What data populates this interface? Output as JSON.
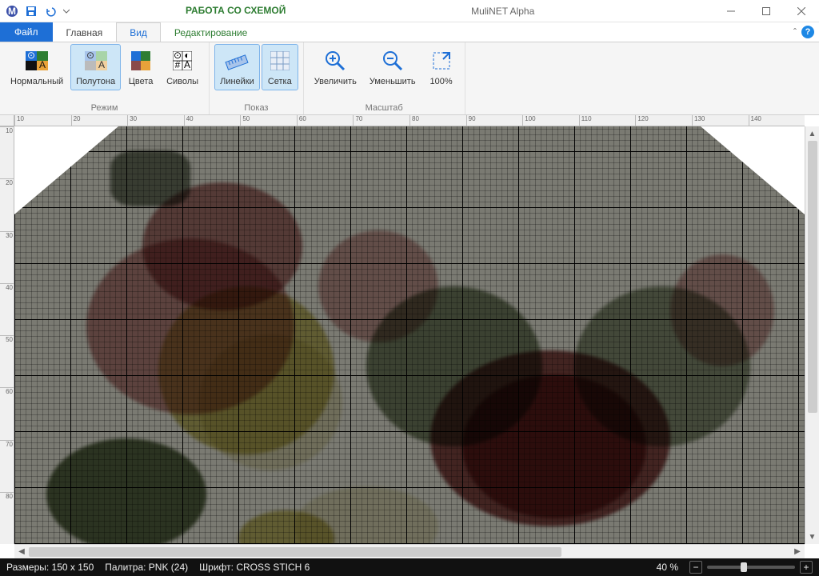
{
  "app": {
    "title": "MuliNET Alpha"
  },
  "context_tab": {
    "title": "РАБОТА СО СХЕМОЙ",
    "subtitle": "Редактирование"
  },
  "tabs": {
    "file": "Файл",
    "home": "Главная",
    "view": "Вид"
  },
  "ribbon": {
    "groups": {
      "mode": {
        "label": "Режим",
        "normal": "Нормальный",
        "halftone": "Полутона",
        "colors": "Цвета",
        "symbols": "Сиволы"
      },
      "show": {
        "label": "Показ",
        "rulers": "Линейки",
        "grid": "Сетка"
      },
      "zoom": {
        "label": "Масштаб",
        "zoom_in": "Увеличить",
        "zoom_out": "Уменьшить",
        "fit": "100%"
      }
    }
  },
  "ruler_marks": [
    "10",
    "20",
    "30",
    "40",
    "50",
    "60",
    "70",
    "80",
    "90",
    "100",
    "110",
    "120",
    "130",
    "140"
  ],
  "status": {
    "dims_label": "Размеры:",
    "dims_value": "150 x 150",
    "palette_label": "Палитра:",
    "palette_value": "PNK (24)",
    "font_label": "Шрифт:",
    "font_value": "CROSS STICH 6",
    "zoom_value": "40 %"
  },
  "colors": {
    "bg_gray": "#7a7a72",
    "rose_pink": "#c08a8a",
    "rose_dark": "#8a4a4a",
    "yellow": "#c9c070",
    "cream": "#e8e4c8",
    "leaf": "#5a6a48",
    "leaf_dark": "#3a4530"
  }
}
